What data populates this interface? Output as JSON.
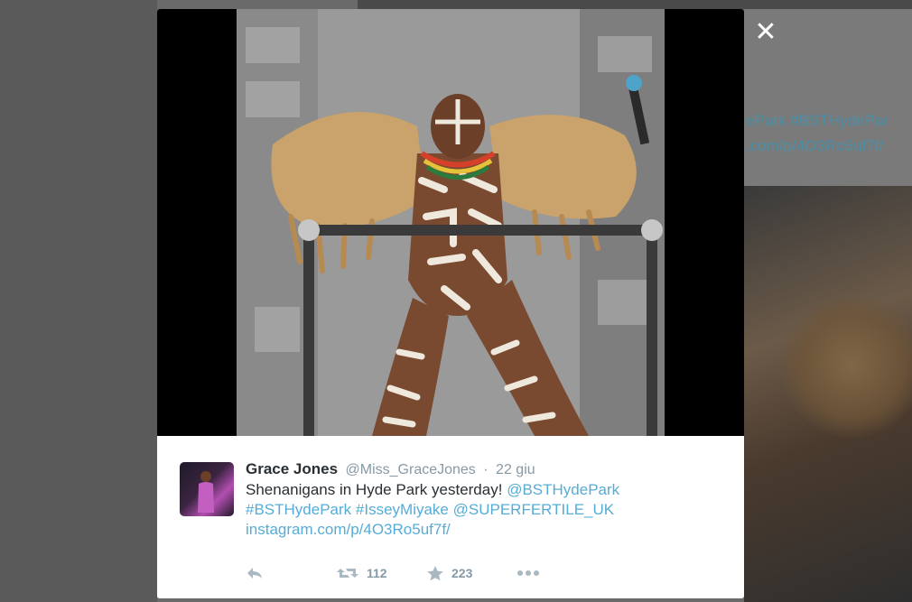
{
  "background": {
    "visible_text_lines": [
      "ePark #BSTHydePar",
      ".com/p/4O3Ro5uf7f/"
    ]
  },
  "close": {
    "label": "✕"
  },
  "tweet": {
    "author_name": "Grace Jones",
    "author_handle": "@Miss_GraceJones",
    "separator": "·",
    "date": "22 giu",
    "text_plain": "Shenanigans in Hyde Park yesterday!",
    "mention_1": "@BSTHydePark",
    "hashtag_1": "#BSTHydePark",
    "hashtag_2": "#IsseyMiyake",
    "mention_2": "@SUPERFERTILE_UK",
    "link": "instagram.com/p/4O3Ro5uf7f/"
  },
  "actions": {
    "reply_icon": "reply-icon",
    "retweet_icon": "retweet-icon",
    "retweet_count": "112",
    "favorite_icon": "star-icon",
    "favorite_count": "223",
    "more_icon": "more-dots-icon"
  },
  "colors": {
    "link": "#56acd6",
    "name": "#292f33",
    "meta": "#8899a6",
    "icon": "#aab8c2"
  }
}
